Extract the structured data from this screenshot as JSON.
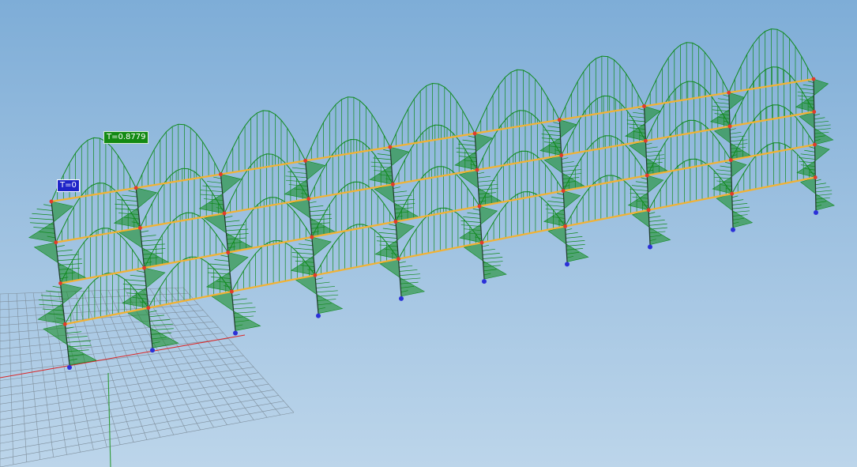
{
  "viewport": {
    "background_top": "#7eadd7",
    "background_bottom": "#bcd5ea",
    "grid_color": "#7f8f9c",
    "axis_x_color": "#d92b2b",
    "axis_y_color": "#2f9a36",
    "diagram_color": "#0f8a1c",
    "beam_color": "#f2b233",
    "node_color": "#e23a2a",
    "support_color": "#2b30d8"
  },
  "labels": {
    "min_value": "T=0",
    "max_value": "T=0.8779"
  },
  "model": {
    "frames": 10,
    "storeys": 4,
    "view": "isometric"
  }
}
